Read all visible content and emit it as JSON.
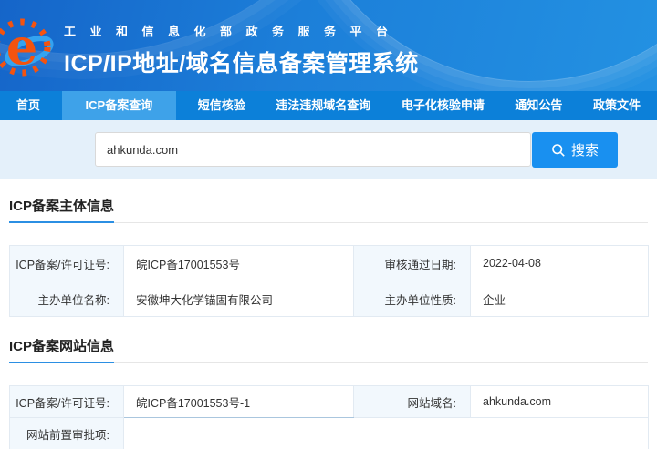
{
  "header": {
    "platform_name": "工业和信息化部政务服务平台",
    "system_title": "ICP/IP地址/域名信息备案管理系统"
  },
  "nav": {
    "items": [
      {
        "label": "首页",
        "active": false
      },
      {
        "label": "ICP备案查询",
        "active": true
      },
      {
        "label": "短信核验",
        "active": false
      },
      {
        "label": "违法违规域名查询",
        "active": false
      },
      {
        "label": "电子化核验申请",
        "active": false
      },
      {
        "label": "通知公告",
        "active": false
      },
      {
        "label": "政策文件",
        "active": false
      }
    ]
  },
  "search": {
    "value": "ahkunda.com",
    "button_label": "搜索",
    "icon": "search-icon"
  },
  "sections": [
    {
      "title": "ICP备案主体信息",
      "rows": [
        [
          {
            "label": "ICP备案/许可证号:",
            "value": "皖ICP备17001553号"
          },
          {
            "label": "审核通过日期:",
            "value": "2022-04-08"
          }
        ],
        [
          {
            "label": "主办单位名称:",
            "value": "安徽坤大化学锚固有限公司"
          },
          {
            "label": "主办单位性质:",
            "value": "企业"
          }
        ]
      ]
    },
    {
      "title": "ICP备案网站信息",
      "rows": [
        [
          {
            "label": "ICP备案/许可证号:",
            "value": "皖ICP备17001553号-1"
          },
          {
            "label": "网站域名:",
            "value": "ahkunda.com"
          }
        ],
        [
          {
            "label": "网站前置审批项:",
            "value": ""
          }
        ]
      ]
    }
  ],
  "colors": {
    "nav_blue": "#0c80d9",
    "nav_active_blue": "#3ea2e9",
    "button_blue": "#1990f0",
    "search_bg": "#e4f0fa",
    "title_underline": "#2b8fe3",
    "table_label_bg": "#f2f8fd",
    "table_border": "#e2eaf2",
    "logo_orange": "#f4530f",
    "logo_swoosh_blue": "#35a7f2"
  }
}
